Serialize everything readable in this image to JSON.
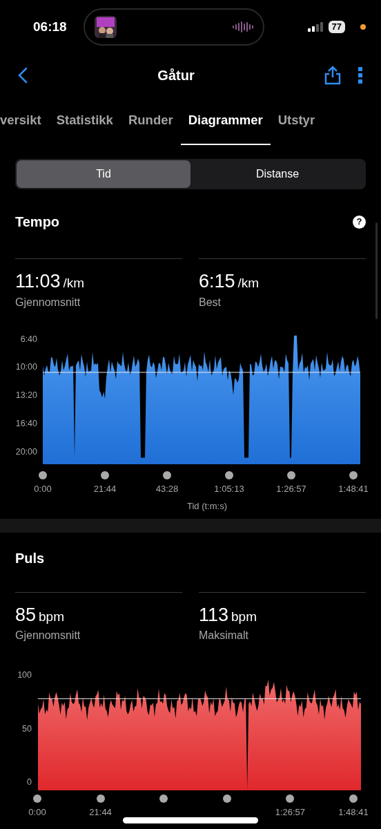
{
  "status_bar": {
    "time": "06:18",
    "battery": "77"
  },
  "nav": {
    "title": "Gåtur"
  },
  "tabs": [
    {
      "label": "versikt",
      "selected": false
    },
    {
      "label": "Statistikk",
      "selected": false
    },
    {
      "label": "Runder",
      "selected": false
    },
    {
      "label": "Diagrammer",
      "selected": true
    },
    {
      "label": "Utstyr",
      "selected": false
    }
  ],
  "segments": [
    {
      "label": "Tid",
      "selected": true
    },
    {
      "label": "Distanse",
      "selected": false
    }
  ],
  "sections": [
    {
      "kind": "pace",
      "title": "Tempo",
      "help": "?",
      "stats": [
        {
          "value": "11:03",
          "unit": "/km",
          "label": "Gjennomsnitt"
        },
        {
          "value": "6:15",
          "unit": "/km",
          "label": "Best"
        }
      ],
      "y_ticks": [
        "6:40",
        "10:00",
        "13:20",
        "16:40",
        "20:00"
      ],
      "x_ticks": [
        {
          "label": "0:00"
        },
        {
          "label": "21:44"
        },
        {
          "label": "43:28"
        },
        {
          "label": "1:05:13"
        },
        {
          "label": "1:26:57"
        },
        {
          "label": "1:48:41"
        }
      ],
      "x_title": "Tid (t:m:s)"
    },
    {
      "kind": "heart",
      "title": "Puls",
      "stats": [
        {
          "value": "85",
          "unit": "bpm",
          "label": "Gjennomsnitt"
        },
        {
          "value": "113",
          "unit": "bpm",
          "label": "Maksimalt"
        }
      ],
      "y_ticks": [
        "100",
        "50",
        "0"
      ],
      "x_ticks": [
        {
          "label": "0:00"
        },
        {
          "label": "21:44"
        },
        {
          "covered": true
        },
        {
          "covered": true
        },
        {
          "label": "1:26:57"
        },
        {
          "label": "1:48:41"
        }
      ]
    }
  ]
}
